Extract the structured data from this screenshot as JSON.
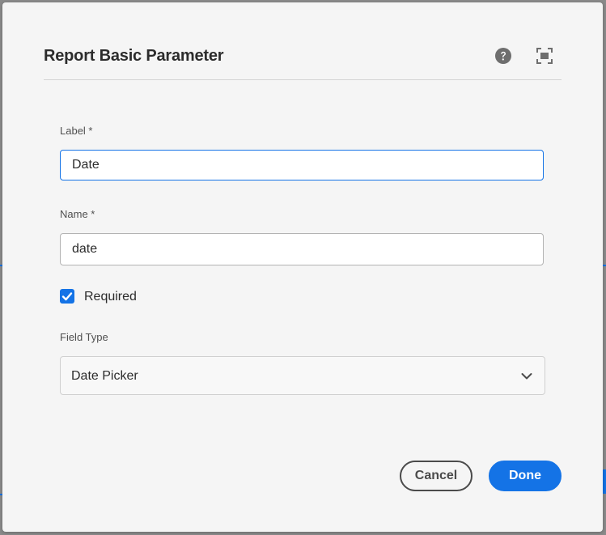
{
  "dialog": {
    "title": "Report Basic Parameter",
    "help_icon": "help-circle-icon",
    "fullscreen_icon": "fullscreen-icon"
  },
  "form": {
    "label_field": {
      "label": "Label *",
      "value": "Date"
    },
    "name_field": {
      "label": "Name *",
      "value": "date"
    },
    "required_checkbox": {
      "label": "Required",
      "checked": true
    },
    "field_type": {
      "label": "Field Type",
      "selected": "Date Picker",
      "icon": "chevron-down-icon"
    }
  },
  "footer": {
    "cancel_label": "Cancel",
    "done_label": "Done"
  },
  "colors": {
    "accent": "#1473e6",
    "dialog_bg": "#f5f5f5",
    "text": "#2c2c2c"
  }
}
